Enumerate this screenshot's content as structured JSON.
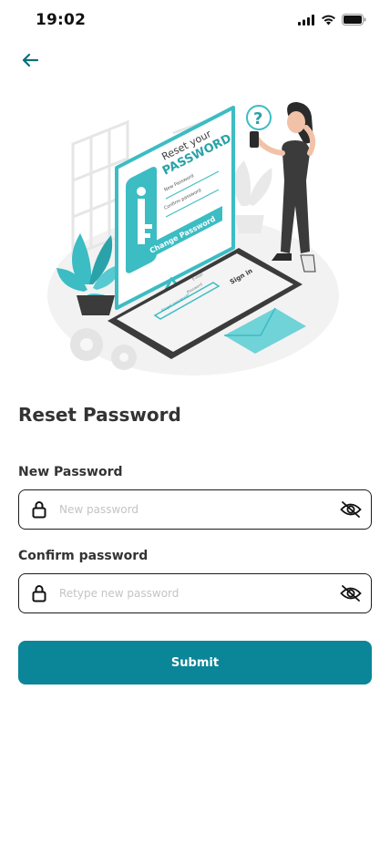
{
  "status_bar": {
    "time": "19:02",
    "icons": [
      "signal-icon",
      "wifi-icon",
      "battery-icon"
    ]
  },
  "header": {
    "back_icon": "back-arrow-icon"
  },
  "illustration": {
    "card_line1": "Reset your",
    "card_line2": "PASSWORD",
    "new_password_hint": "New Password",
    "confirm_password_hint": "Confirm password",
    "change_button": "Change Password",
    "phone_title": "Sign in",
    "phone_email": "E-mail",
    "phone_password": "Password",
    "phone_forgot": "Forgot password?",
    "question_mark": "?"
  },
  "page": {
    "title": "Reset Password"
  },
  "form": {
    "new_password": {
      "label": "New Password",
      "placeholder": "New password",
      "value": ""
    },
    "confirm_password": {
      "label": "Confirm password",
      "placeholder": "Retype new password",
      "value": ""
    },
    "submit_label": "Submit"
  },
  "colors": {
    "accent": "#0b8598",
    "illustration_teal": "#3cbcc3",
    "text": "#333333",
    "placeholder": "#c4c4c4"
  }
}
